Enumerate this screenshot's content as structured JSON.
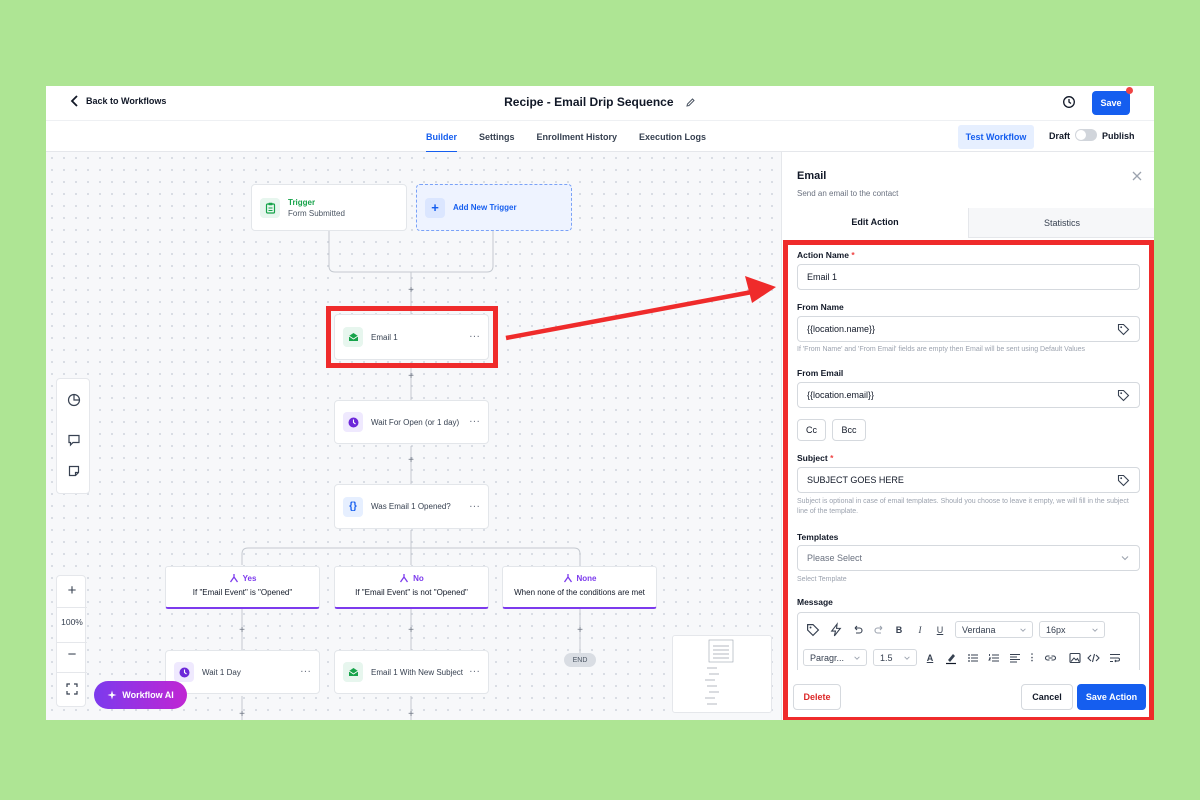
{
  "header": {
    "back_label": "Back to Workflows",
    "title": "Recipe - Email Drip Sequence",
    "save_label": "Save"
  },
  "subnav": {
    "tabs": [
      {
        "label": "Builder",
        "active": true
      },
      {
        "label": "Settings",
        "active": false
      },
      {
        "label": "Enrollment History",
        "active": false
      },
      {
        "label": "Execution Logs",
        "active": false
      }
    ],
    "test_label": "Test Workflow",
    "draft_label": "Draft",
    "publish_label": "Publish",
    "publish_enabled": false
  },
  "canvas": {
    "trigger": {
      "label": "Trigger",
      "sub": "Form Submitted"
    },
    "add_trigger_label": "Add New Trigger",
    "nodes": {
      "email1": "Email 1",
      "wait_open": "Wait For Open (or 1 day)",
      "condition": "Was Email 1 Opened?",
      "wait1": "Wait 1 Day",
      "email_new_subject": "Email 1 With New Subject"
    },
    "branches": [
      {
        "label": "Yes",
        "condition": "If \"Email Event\" is \"Opened\""
      },
      {
        "label": "No",
        "condition": "If \"Email Event\" is not \"Opened\""
      },
      {
        "label": "None",
        "condition": "When none of the conditions are met"
      }
    ],
    "end_label": "END",
    "zoom_label": "100%",
    "workflow_ai_label": "Workflow AI"
  },
  "panel": {
    "title": "Email",
    "subtitle": "Send an email to the contact",
    "tabs": [
      "Edit Action",
      "Statistics"
    ],
    "action_name_label": "Action Name",
    "action_name_value": "Email 1",
    "from_name_label": "From Name",
    "from_name_value": "{{location.name}}",
    "from_name_hint": "If 'From Name' and 'From Email' fields are empty then Email will be sent using Default Values",
    "from_email_label": "From Email",
    "from_email_value": "{{location.email}}",
    "cc_label": "Cc",
    "bcc_label": "Bcc",
    "subject_label": "Subject",
    "subject_value": "SUBJECT GOES HERE",
    "subject_hint": "Subject is optional in case of email templates. Should you choose to leave it empty, we will fill in the subject line of the template.",
    "templates_label": "Templates",
    "templates_placeholder": "Please Select",
    "templates_hint": "Select Template",
    "message_label": "Message",
    "toolbar": {
      "font": "Verdana",
      "size": "16px",
      "block": "Paragr...",
      "line_height": "1.5"
    },
    "delete_label": "Delete",
    "cancel_label": "Cancel",
    "save_action_label": "Save Action"
  },
  "colors": {
    "primary": "#155eef",
    "highlight": "#ef2b2b",
    "branch_accent": "#7c3aed",
    "background": "#aee594"
  }
}
